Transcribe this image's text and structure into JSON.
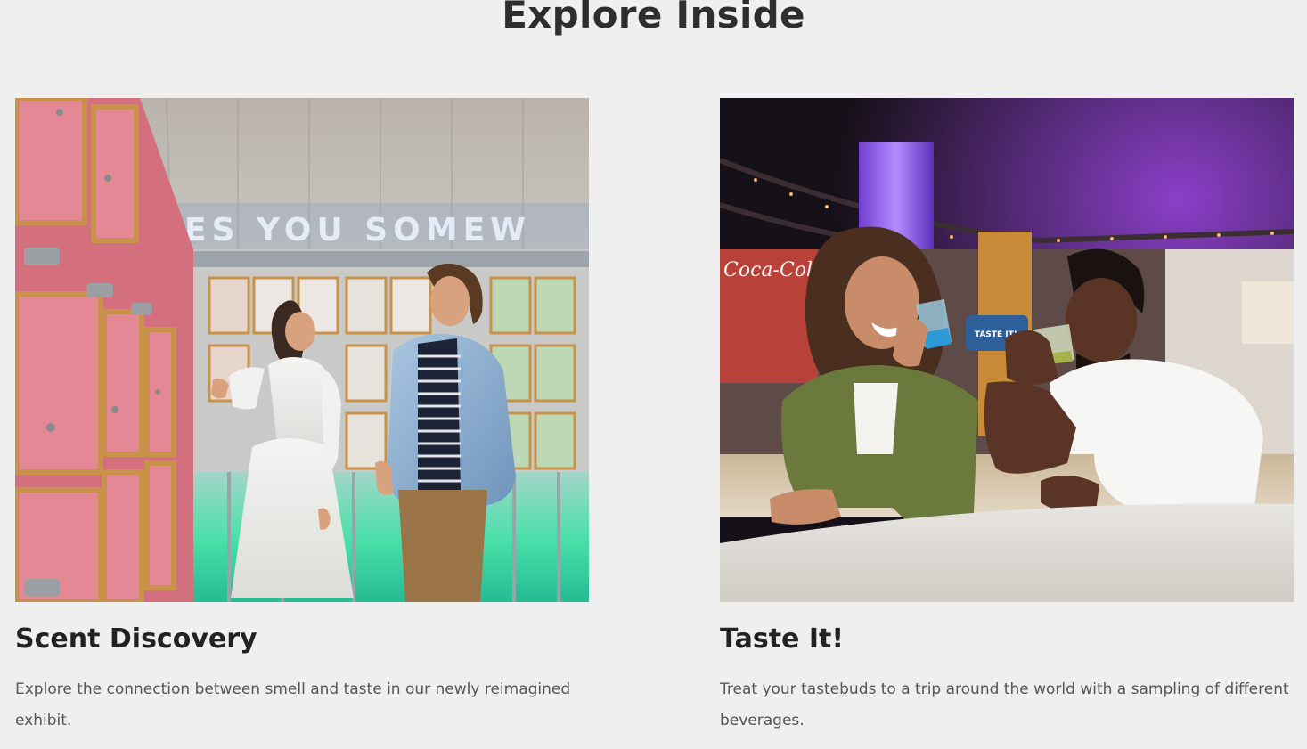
{
  "section": {
    "title": "Explore Inside"
  },
  "cards": [
    {
      "title": "Scent Discovery",
      "description": "Explore the connection between smell and taste in our newly reimagined exhibit.",
      "image_sign_text": "ES  YOU  SOMEW"
    },
    {
      "title": "Taste It!",
      "description": "Treat your tastebuds to a trip around the world with a sampling of different beverages.",
      "image_store_text": "Coca-Cola Store",
      "image_kiosk_text": "TASTE IT!"
    }
  ],
  "colors": {
    "background": "#efefef",
    "heading": "#2e2e2e",
    "body_text": "#555555",
    "locker_pink": "#e07a86",
    "locker_wood": "#c8924a",
    "locker_mint": "#bcd8b4",
    "floor_glow": "#2fe0a0"
  }
}
